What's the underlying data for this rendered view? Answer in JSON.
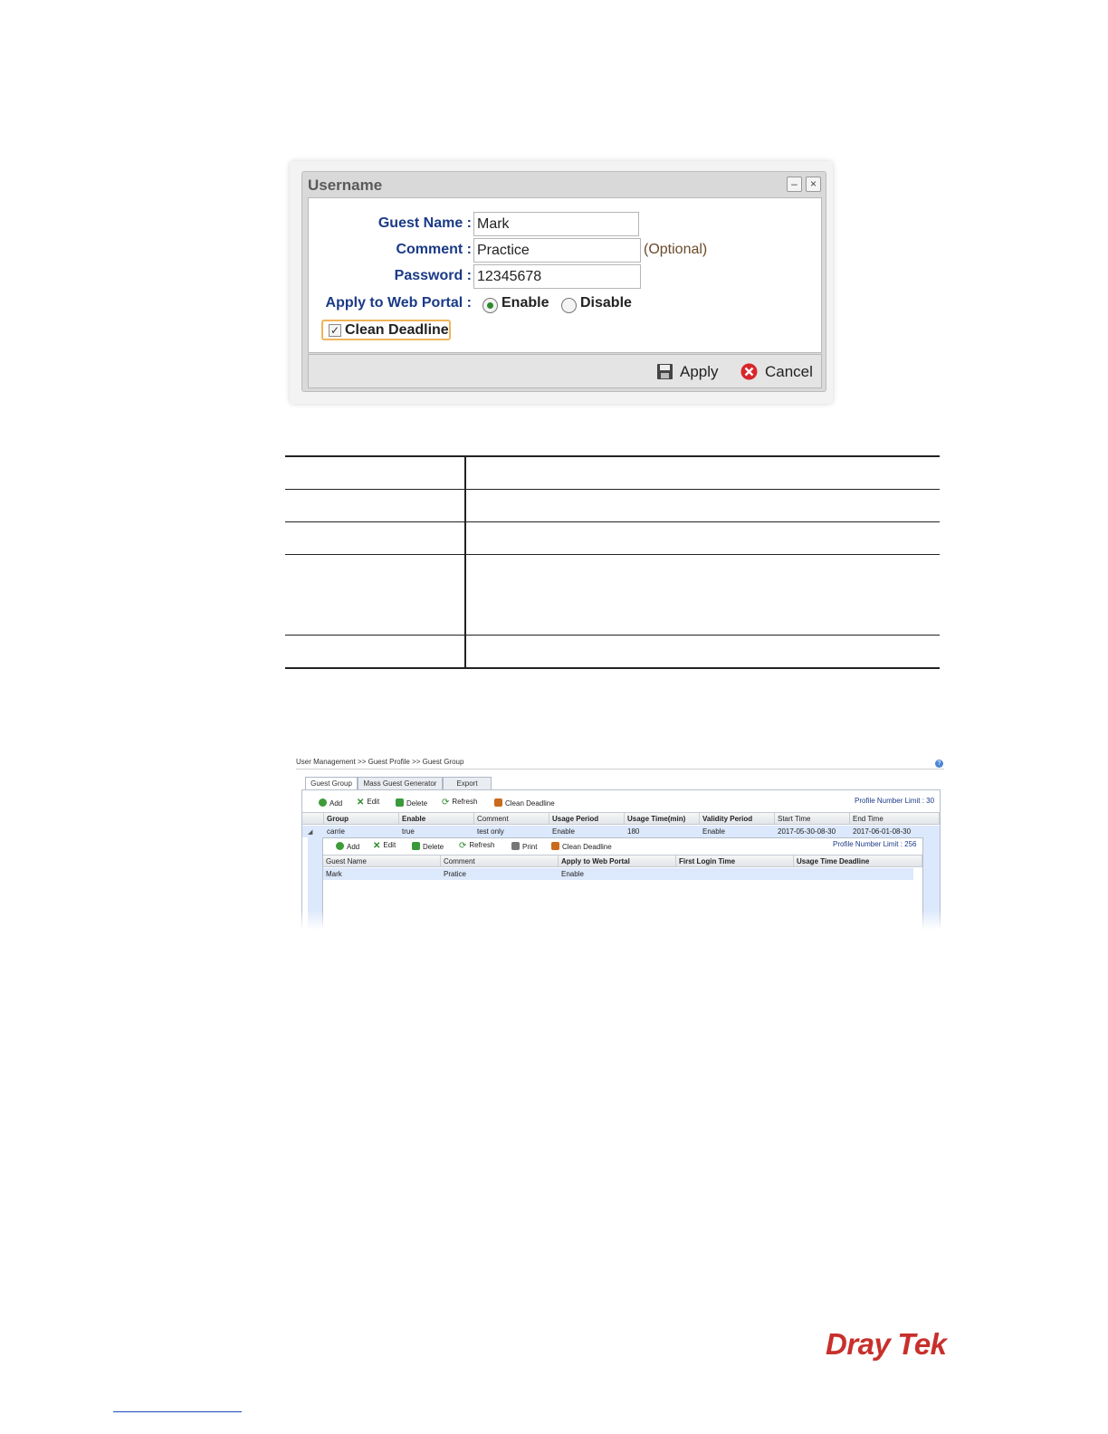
{
  "dialog": {
    "title": "Username",
    "minimize_glyph": "–",
    "close_glyph": "×",
    "fields": {
      "guest_name_label": "Guest Name :",
      "guest_name_value": "Mark",
      "comment_label": "Comment :",
      "comment_value": "Practice",
      "comment_hint": "(Optional)",
      "password_label": "Password :",
      "password_value": "12345678"
    },
    "web_portal": {
      "label": "Apply to Web Portal :",
      "enable_label": "Enable",
      "disable_label": "Disable",
      "selected": "Enable"
    },
    "clean_deadline": {
      "label": "Clean Deadline",
      "checked": true,
      "check_glyph": "✓"
    },
    "footer": {
      "apply_label": "Apply",
      "cancel_label": "Cancel"
    }
  },
  "guest_group": {
    "breadcrumb": "User Management >> Guest Profile >> Guest Group",
    "help_glyph": "?",
    "tabs": [
      "Guest Group",
      "Mass Guest Generator",
      "Export"
    ],
    "toolbar": {
      "add": "Add",
      "edit": "Edit",
      "delete": "Delete",
      "refresh": "Refresh",
      "clean_deadline": "Clean Deadline",
      "limit": "Profile Number Limit : 30"
    },
    "columns": [
      "Group",
      "Enable",
      "Comment",
      "Usage Period",
      "Usage Time(min)",
      "Validity Period",
      "Start Time",
      "End Time"
    ],
    "row": [
      "carrie",
      "true",
      "test only",
      "Enable",
      "180",
      "Enable",
      "2017-05-30-08-30",
      "2017-06-01-08-30"
    ],
    "sub": {
      "toolbar": {
        "add": "Add",
        "edit": "Edit",
        "delete": "Delete",
        "refresh": "Refresh",
        "print": "Print",
        "clean_deadline": "Clean Deadline",
        "limit": "Profile Number Limit : 256"
      },
      "columns": [
        "Guest Name",
        "Comment",
        "Apply to Web Portal",
        "First Login Time",
        "Usage Time Deadline"
      ],
      "row": [
        "Mark",
        "Pratice",
        "Enable",
        "",
        ""
      ]
    }
  },
  "brand": {
    "logo_part1": "Dray",
    "logo_part2": "Tek",
    "logo_color": "#c8302c"
  }
}
